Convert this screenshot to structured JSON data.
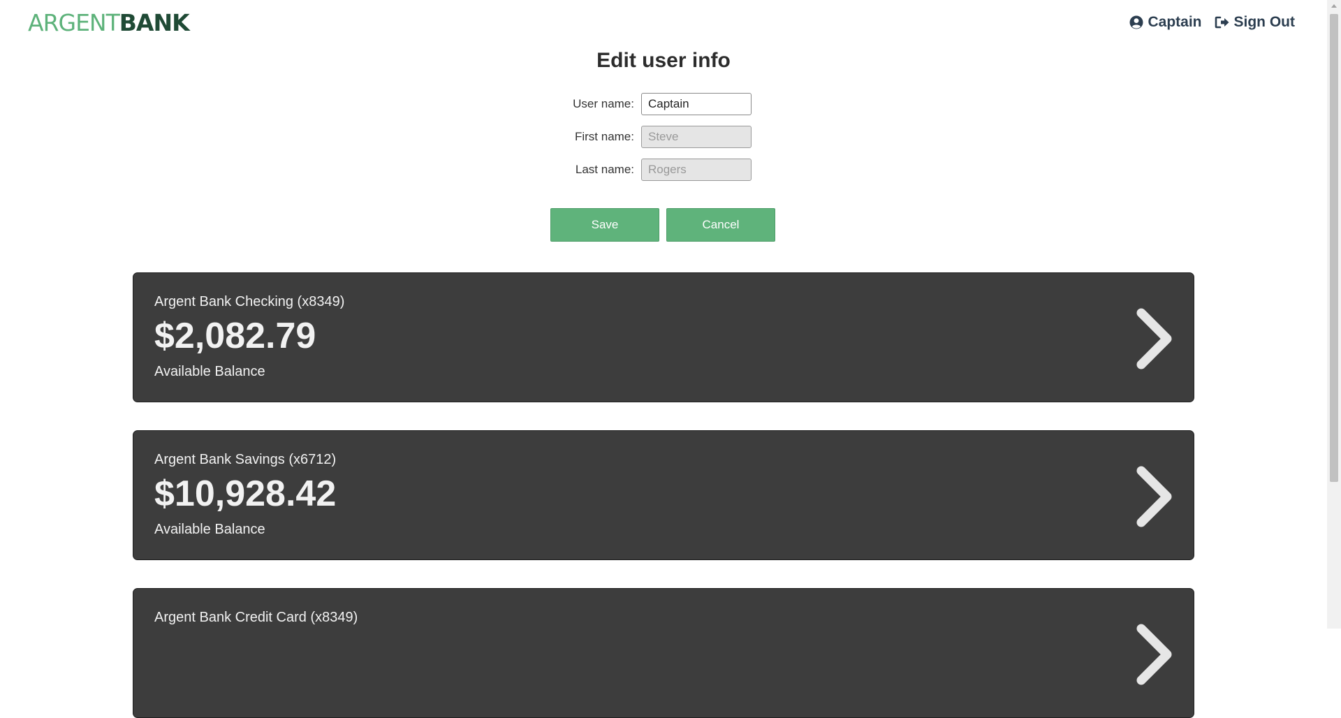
{
  "header": {
    "logo_part1": "ARGENT",
    "logo_part2": "BANK",
    "user_label": "Captain",
    "user_icon": "user-circle-icon",
    "signout_label": "Sign Out",
    "signout_icon": "sign-out-icon"
  },
  "form": {
    "title": "Edit user info",
    "username_label": "User name:",
    "username_value": "Captain",
    "firstname_label": "First name:",
    "firstname_value": "Steve",
    "lastname_label": "Last name:",
    "lastname_value": "Rogers",
    "save_label": "Save",
    "cancel_label": "Cancel"
  },
  "accounts": [
    {
      "title": "Argent Bank Checking (x8349)",
      "amount": "$2,082.79",
      "description": "Available Balance"
    },
    {
      "title": "Argent Bank Savings (x6712)",
      "amount": "$10,928.42",
      "description": "Available Balance"
    },
    {
      "title": "Argent Bank Credit Card (x8349)",
      "amount": "",
      "description": ""
    }
  ],
  "colors": {
    "brand_green": "#5db27a",
    "brand_dark": "#1f4a35",
    "button": "#5fb37b",
    "card_bg": "#3d3d3d"
  }
}
